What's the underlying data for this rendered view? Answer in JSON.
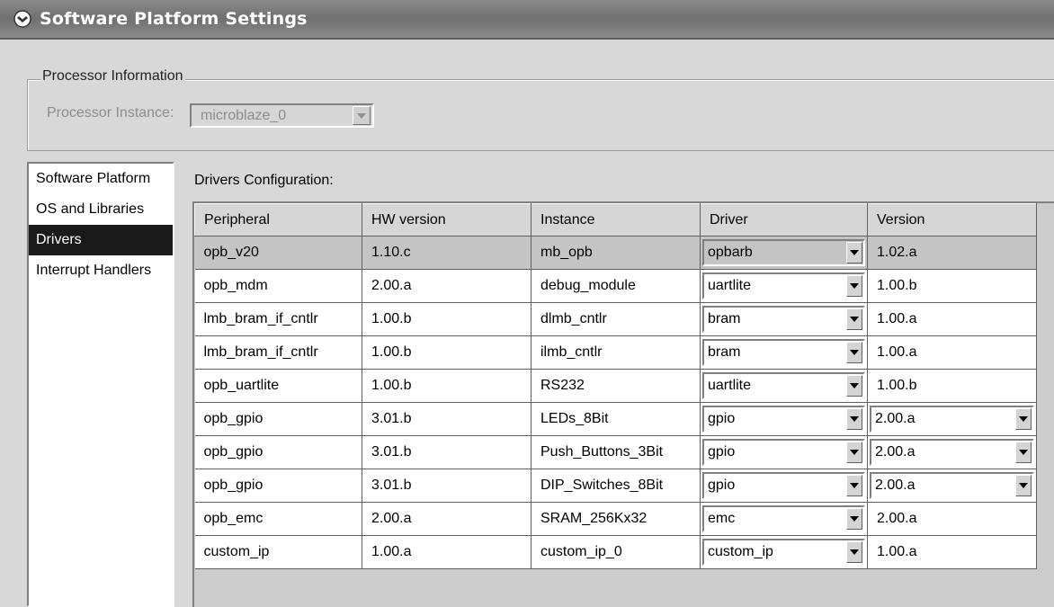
{
  "window": {
    "title": "Software Platform Settings"
  },
  "processor": {
    "group_label": "Processor Information",
    "instance_label": "Processor Instance:",
    "instance_value": "microblaze_0"
  },
  "sidebar": {
    "items": [
      {
        "label": "Software Platform",
        "selected": false
      },
      {
        "label": "OS and Libraries",
        "selected": false
      },
      {
        "label": "Drivers",
        "selected": true
      },
      {
        "label": "Interrupt Handlers",
        "selected": false
      }
    ]
  },
  "drivers": {
    "label": "Drivers Configuration:",
    "columns": [
      "Peripheral",
      "HW version",
      "Instance",
      "Driver",
      "Version"
    ],
    "rows": [
      {
        "peripheral": "opb_v20",
        "hw_version": "1.10.c",
        "instance": "mb_opb",
        "driver": "opbarb",
        "version": "1.02.a",
        "version_dropdown": false,
        "selected": true
      },
      {
        "peripheral": "opb_mdm",
        "hw_version": "2.00.a",
        "instance": "debug_module",
        "driver": "uartlite",
        "version": "1.00.b",
        "version_dropdown": false,
        "selected": false
      },
      {
        "peripheral": "lmb_bram_if_cntlr",
        "hw_version": "1.00.b",
        "instance": "dlmb_cntlr",
        "driver": "bram",
        "version": "1.00.a",
        "version_dropdown": false,
        "selected": false
      },
      {
        "peripheral": "lmb_bram_if_cntlr",
        "hw_version": "1.00.b",
        "instance": "ilmb_cntlr",
        "driver": "bram",
        "version": "1.00.a",
        "version_dropdown": false,
        "selected": false
      },
      {
        "peripheral": "opb_uartlite",
        "hw_version": "1.00.b",
        "instance": "RS232",
        "driver": "uartlite",
        "version": "1.00.b",
        "version_dropdown": false,
        "selected": false
      },
      {
        "peripheral": "opb_gpio",
        "hw_version": "3.01.b",
        "instance": "LEDs_8Bit",
        "driver": "gpio",
        "version": "2.00.a",
        "version_dropdown": true,
        "selected": false
      },
      {
        "peripheral": "opb_gpio",
        "hw_version": "3.01.b",
        "instance": "Push_Buttons_3Bit",
        "driver": "gpio",
        "version": "2.00.a",
        "version_dropdown": true,
        "selected": false
      },
      {
        "peripheral": "opb_gpio",
        "hw_version": "3.01.b",
        "instance": "DIP_Switches_8Bit",
        "driver": "gpio",
        "version": "2.00.a",
        "version_dropdown": true,
        "selected": false
      },
      {
        "peripheral": "opb_emc",
        "hw_version": "2.00.a",
        "instance": "SRAM_256Kx32",
        "driver": "emc",
        "version": "2.00.a",
        "version_dropdown": false,
        "selected": false
      },
      {
        "peripheral": "custom_ip",
        "hw_version": "1.00.a",
        "instance": "custom_ip_0",
        "driver": "custom_ip",
        "version": "1.00.a",
        "version_dropdown": false,
        "selected": false
      }
    ]
  },
  "icons": {
    "app": "app-icon",
    "dropdown": "chevron-down-icon"
  }
}
